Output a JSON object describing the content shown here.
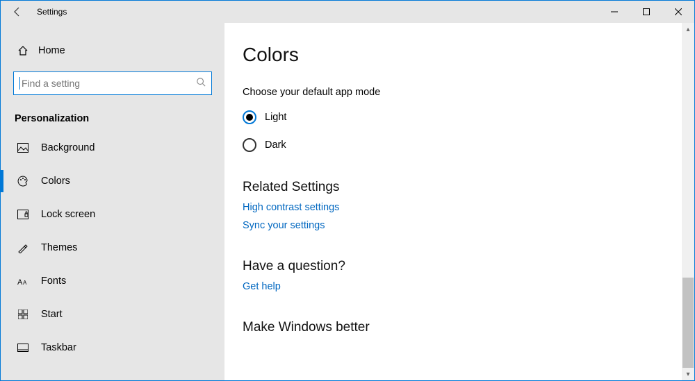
{
  "window": {
    "title": "Settings"
  },
  "sidebar": {
    "home": "Home",
    "search": {
      "placeholder": "Find a setting"
    },
    "category": "Personalization",
    "items": [
      {
        "label": "Background"
      },
      {
        "label": "Colors"
      },
      {
        "label": "Lock screen"
      },
      {
        "label": "Themes"
      },
      {
        "label": "Fonts"
      },
      {
        "label": "Start"
      },
      {
        "label": "Taskbar"
      }
    ]
  },
  "main": {
    "title": "Colors",
    "mode_label": "Choose your default app mode",
    "options": {
      "light": "Light",
      "dark": "Dark"
    },
    "related_heading": "Related Settings",
    "links": {
      "high_contrast": "High contrast settings",
      "sync": "Sync your settings"
    },
    "question_heading": "Have a question?",
    "get_help": "Get help",
    "better_heading": "Make Windows better"
  }
}
